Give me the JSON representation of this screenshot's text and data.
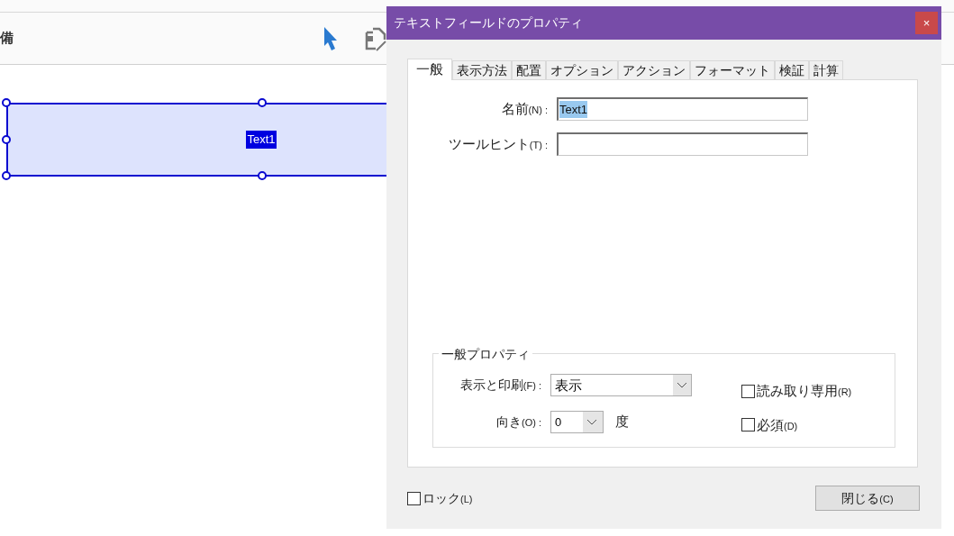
{
  "toolbar": {
    "text": "備"
  },
  "form_field": {
    "name": "Text1"
  },
  "dialog": {
    "title": "テキストフィールドのプロパティ",
    "close": "×",
    "tabs": [
      {
        "label": "一般",
        "selected": true
      },
      {
        "label": "表示方法",
        "selected": false
      },
      {
        "label": "配置",
        "selected": false
      },
      {
        "label": "オプション",
        "selected": false
      },
      {
        "label": "アクション",
        "selected": false
      },
      {
        "label": "フォーマット",
        "selected": false
      },
      {
        "label": "検証",
        "selected": false
      },
      {
        "label": "計算",
        "selected": false
      }
    ],
    "fields": [
      {
        "label": "名前",
        "key": "(N) :",
        "value": "Text1",
        "selected_text": true
      },
      {
        "label": "ツールヒント",
        "key": "(T) :"
      }
    ],
    "group": {
      "title": "一般プロパティ",
      "visibility": {
        "label": "表示と印刷",
        "key": "(F) :",
        "value": "表示"
      },
      "orientation": {
        "label": "向き",
        "key": "(O) :",
        "value": "0",
        "unit": "度"
      },
      "checkboxes": [
        {
          "label": "読み取り専用",
          "key": "(R)",
          "checked": false
        },
        {
          "label": "必須",
          "key": "(D)",
          "checked": false
        }
      ]
    },
    "lock": {
      "label": "ロック",
      "key": "(L)",
      "checked": false
    },
    "close_button": {
      "label": "閉じる",
      "key": "(C)"
    }
  }
}
